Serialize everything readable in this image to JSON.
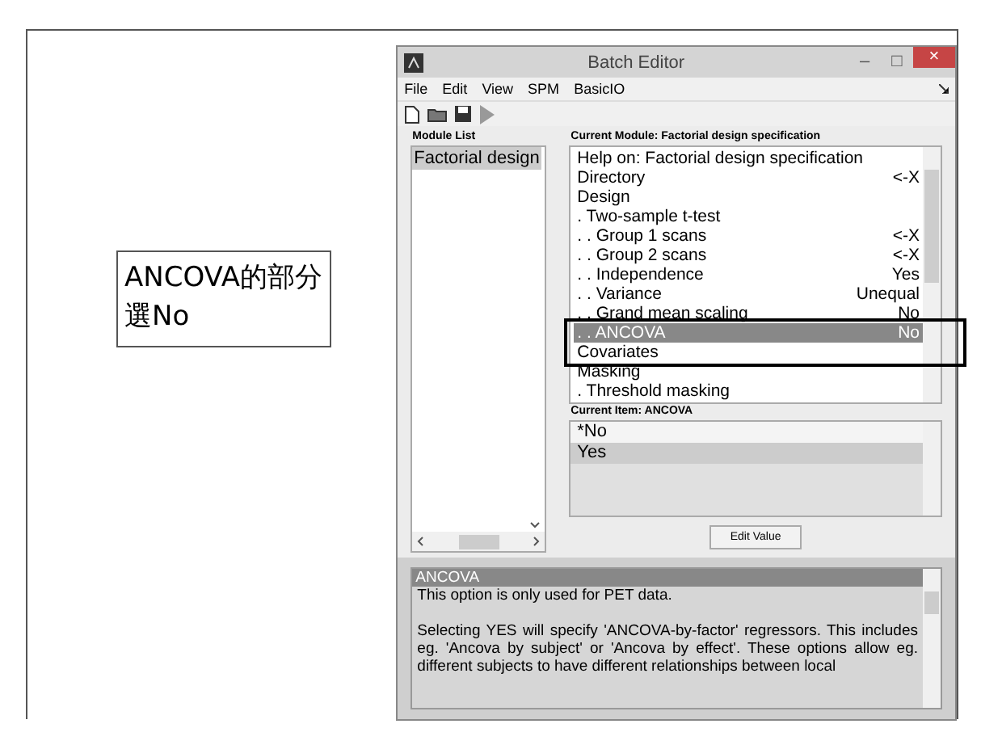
{
  "callout": {
    "line1": "ANCOVA的部分",
    "line2": "選No"
  },
  "window": {
    "title": "Batch Editor",
    "minimize": "–",
    "maximize": "□",
    "close": "×"
  },
  "menu": [
    {
      "label": "File"
    },
    {
      "label": "Edit"
    },
    {
      "label": "View"
    },
    {
      "label": "SPM"
    },
    {
      "label": "BasicIO"
    }
  ],
  "module_list": {
    "heading": "Module List",
    "items": [
      {
        "label": "Factorial design",
        "selected": true
      }
    ]
  },
  "current_module": {
    "heading": "Current Module: Factorial design specification",
    "items": [
      {
        "label": "Help on: Factorial design specification",
        "selected": false
      },
      {
        "label": "Directory",
        "value": "<-X",
        "selected": false
      },
      {
        "label": "Design",
        "selected": false
      },
      {
        "label": ". Two-sample t-test",
        "selected": false
      },
      {
        "label": ". . Group 1 scans",
        "value": "<-X",
        "selected": false
      },
      {
        "label": ". . Group 2 scans",
        "value": "<-X",
        "selected": false
      },
      {
        "label": ". . Independence",
        "value": "Yes",
        "selected": false
      },
      {
        "label": ". . Variance",
        "value": "Unequal",
        "selected": false
      },
      {
        "label": ". . Grand mean scaling",
        "value": "No",
        "selected": false
      },
      {
        "label": ". . ANCOVA",
        "value": "No",
        "selected": true
      },
      {
        "label": "Covariates",
        "selected": false
      },
      {
        "label": "Masking",
        "selected": false
      },
      {
        "label": ". Threshold masking",
        "selected": false
      }
    ]
  },
  "current_item": {
    "heading": "Current Item: ANCOVA",
    "options": [
      {
        "label": "*No",
        "selected": false
      },
      {
        "label": "Yes",
        "selected": true
      }
    ]
  },
  "edit_button": "Edit Value",
  "help": {
    "title": "ANCOVA",
    "paragraphs": [
      "This option is only used for PET data.",
      "Selecting YES will specify 'ANCOVA-by-factor' regressors. This includes eg. 'Ancova by subject' or 'Ancova by effect'. These options allow eg. different subjects to have different relationships between local"
    ]
  }
}
